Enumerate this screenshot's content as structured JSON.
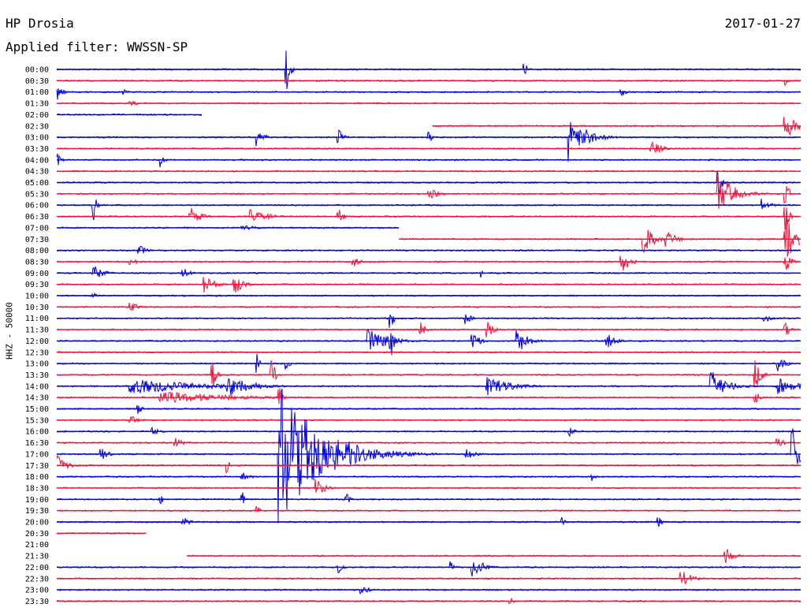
{
  "header": {
    "station": "HP Drosia",
    "date": "2017-01-27",
    "filter": "Applied filter: WWSSN-SP"
  },
  "chart_data": {
    "type": "line",
    "title": "HP Drosia",
    "subtitle": "Applied filter: WWSSN-SP",
    "ylabel": "HHZ - 50000",
    "colors": {
      "even_row": "#0000e0",
      "odd_row": "#f0143c"
    },
    "rows": [
      {
        "time": "00:00",
        "end": 1.0,
        "events": [
          [
            0.31,
            30,
            0.004
          ],
          [
            0.63,
            8,
            0.004
          ]
        ]
      },
      {
        "time": "00:30",
        "end": 1.0,
        "events": [
          [
            0.98,
            9,
            0.004
          ]
        ]
      },
      {
        "time": "01:00",
        "end": 1.0,
        "events": [
          [
            0.0,
            14,
            0.006
          ],
          [
            0.09,
            5,
            0.004
          ],
          [
            0.76,
            6,
            0.005
          ]
        ]
      },
      {
        "time": "01:30",
        "end": 1.0,
        "events": [
          [
            0.1,
            4,
            0.008
          ]
        ]
      },
      {
        "time": "02:00",
        "end": 0.195,
        "events": []
      },
      {
        "time": "02:30",
        "start": 0.505,
        "end": 1.0,
        "events": [
          [
            0.98,
            18,
            0.012
          ]
        ]
      },
      {
        "time": "03:00",
        "end": 1.0,
        "events": [
          [
            0.27,
            14,
            0.007
          ],
          [
            0.38,
            10,
            0.006
          ],
          [
            0.5,
            7,
            0.005
          ],
          [
            0.69,
            32,
            0.02
          ]
        ]
      },
      {
        "time": "03:30",
        "end": 1.0,
        "events": [
          [
            0.8,
            10,
            0.012
          ]
        ]
      },
      {
        "time": "04:00",
        "end": 1.0,
        "events": [
          [
            0.0,
            12,
            0.005
          ],
          [
            0.14,
            10,
            0.004
          ]
        ]
      },
      {
        "time": "04:30",
        "end": 1.0,
        "events": []
      },
      {
        "time": "05:00",
        "end": 1.0,
        "events": [
          [
            0.89,
            22,
            0.004
          ]
        ]
      },
      {
        "time": "05:30",
        "end": 1.0,
        "events": [
          [
            0.5,
            8,
            0.012
          ],
          [
            0.89,
            28,
            0.02
          ],
          [
            0.98,
            14,
            0.006
          ]
        ]
      },
      {
        "time": "06:00",
        "end": 1.0,
        "events": [
          [
            0.05,
            22,
            0.003
          ],
          [
            0.95,
            10,
            0.008
          ]
        ]
      },
      {
        "time": "06:30",
        "end": 1.0,
        "events": [
          [
            0.18,
            13,
            0.012
          ],
          [
            0.26,
            11,
            0.02
          ],
          [
            0.38,
            9,
            0.006
          ],
          [
            0.98,
            24,
            0.004
          ]
        ]
      },
      {
        "time": "07:00",
        "end": 0.46,
        "events": [
          [
            0.25,
            4,
            0.02
          ]
        ]
      },
      {
        "time": "07:30",
        "start": 0.46,
        "end": 1.0,
        "events": [
          [
            0.79,
            20,
            0.012
          ],
          [
            0.82,
            10,
            0.015
          ],
          [
            0.98,
            34,
            0.012
          ]
        ]
      },
      {
        "time": "08:00",
        "end": 1.0,
        "events": [
          [
            0.11,
            9,
            0.008
          ]
        ]
      },
      {
        "time": "08:30",
        "end": 1.0,
        "events": [
          [
            0.1,
            5,
            0.01
          ],
          [
            0.4,
            8,
            0.006
          ],
          [
            0.76,
            20,
            0.008
          ],
          [
            0.98,
            15,
            0.006
          ]
        ]
      },
      {
        "time": "09:00",
        "end": 1.0,
        "events": [
          [
            0.05,
            10,
            0.012
          ],
          [
            0.17,
            8,
            0.008
          ],
          [
            0.57,
            6,
            0.003
          ]
        ]
      },
      {
        "time": "09:30",
        "end": 1.0,
        "events": [
          [
            0.2,
            11,
            0.012
          ],
          [
            0.24,
            13,
            0.01
          ]
        ]
      },
      {
        "time": "10:00",
        "end": 1.0,
        "events": [
          [
            0.05,
            6,
            0.003
          ]
        ]
      },
      {
        "time": "10:30",
        "end": 1.0,
        "events": [
          [
            0.1,
            6,
            0.01
          ]
        ]
      },
      {
        "time": "11:00",
        "end": 1.0,
        "events": [
          [
            0.45,
            14,
            0.004
          ],
          [
            0.55,
            8,
            0.008
          ],
          [
            0.95,
            6,
            0.01
          ]
        ]
      },
      {
        "time": "11:30",
        "end": 1.0,
        "events": [
          [
            0.49,
            10,
            0.006
          ],
          [
            0.58,
            10,
            0.01
          ],
          [
            0.98,
            9,
            0.006
          ]
        ]
      },
      {
        "time": "12:00",
        "end": 1.0,
        "events": [
          [
            0.42,
            16,
            0.025
          ],
          [
            0.45,
            22,
            0.004
          ],
          [
            0.56,
            10,
            0.01
          ],
          [
            0.62,
            18,
            0.012
          ],
          [
            0.74,
            10,
            0.01
          ]
        ]
      },
      {
        "time": "12:30",
        "end": 1.0,
        "events": []
      },
      {
        "time": "13:00",
        "end": 1.0,
        "events": [
          [
            0.27,
            14,
            0.003
          ],
          [
            0.31,
            8,
            0.004
          ],
          [
            0.97,
            10,
            0.01
          ]
        ]
      },
      {
        "time": "13:30",
        "end": 1.0,
        "events": [
          [
            0.21,
            22,
            0.004
          ],
          [
            0.29,
            20,
            0.004
          ],
          [
            0.94,
            22,
            0.006
          ]
        ]
      },
      {
        "time": "14:00",
        "end": 1.0,
        "events": [
          [
            0.1,
            10,
            0.09
          ],
          [
            0.23,
            14,
            0.03
          ],
          [
            0.58,
            12,
            0.03
          ],
          [
            0.88,
            20,
            0.02
          ],
          [
            0.97,
            10,
            0.03
          ]
        ]
      },
      {
        "time": "14:30",
        "end": 1.0,
        "events": [
          [
            0.14,
            8,
            0.09
          ],
          [
            0.3,
            12,
            0.004
          ],
          [
            0.94,
            10,
            0.004
          ]
        ]
      },
      {
        "time": "15:00",
        "end": 1.0,
        "events": [
          [
            0.11,
            8,
            0.004
          ]
        ]
      },
      {
        "time": "15:30",
        "end": 1.0,
        "events": [
          [
            0.1,
            6,
            0.01
          ]
        ]
      },
      {
        "time": "16:00",
        "end": 1.0,
        "events": [
          [
            0.13,
            5,
            0.01
          ],
          [
            0.69,
            6,
            0.006
          ]
        ]
      },
      {
        "time": "16:30",
        "end": 1.0,
        "events": [
          [
            0.16,
            6,
            0.01
          ],
          [
            0.97,
            6,
            0.01
          ]
        ]
      },
      {
        "time": "17:00",
        "end": 1.0,
        "events": [
          [
            0.3,
            90,
            0.05
          ],
          [
            0.39,
            18,
            0.035
          ],
          [
            0.06,
            8,
            0.01
          ],
          [
            0.55,
            8,
            0.012
          ],
          [
            0.99,
            34,
            0.01
          ]
        ]
      },
      {
        "time": "17:30",
        "end": 1.0,
        "events": [
          [
            0.0,
            14,
            0.012
          ],
          [
            0.23,
            10,
            0.003
          ]
        ]
      },
      {
        "time": "18:00",
        "end": 1.0,
        "events": [
          [
            0.25,
            6,
            0.01
          ],
          [
            0.72,
            8,
            0.003
          ]
        ]
      },
      {
        "time": "18:30",
        "end": 1.0,
        "events": [
          [
            0.35,
            12,
            0.01
          ]
        ]
      },
      {
        "time": "19:00",
        "end": 1.0,
        "events": [
          [
            0.14,
            8,
            0.003
          ],
          [
            0.25,
            10,
            0.003
          ],
          [
            0.39,
            8,
            0.004
          ]
        ]
      },
      {
        "time": "19:30",
        "end": 1.0,
        "events": [
          [
            0.27,
            6,
            0.004
          ]
        ]
      },
      {
        "time": "20:00",
        "end": 1.0,
        "events": [
          [
            0.17,
            6,
            0.01
          ],
          [
            0.68,
            8,
            0.003
          ],
          [
            0.81,
            6,
            0.004
          ]
        ]
      },
      {
        "time": "20:30",
        "end": 0.12,
        "events": []
      },
      {
        "time": "21:00",
        "end": 0.0,
        "events": []
      },
      {
        "time": "21:30",
        "start": 0.175,
        "end": 1.0,
        "events": [
          [
            0.9,
            10,
            0.01
          ]
        ]
      },
      {
        "time": "22:00",
        "end": 1.0,
        "events": [
          [
            0.38,
            8,
            0.005
          ],
          [
            0.53,
            8,
            0.004
          ],
          [
            0.56,
            16,
            0.012
          ]
        ]
      },
      {
        "time": "22:30",
        "end": 1.0,
        "events": [
          [
            0.84,
            14,
            0.012
          ]
        ]
      },
      {
        "time": "23:00",
        "end": 1.0,
        "events": [
          [
            0.41,
            6,
            0.01
          ]
        ]
      },
      {
        "time": "23:30",
        "end": 1.0,
        "events": [
          [
            0.61,
            6,
            0.004
          ]
        ]
      }
    ]
  }
}
